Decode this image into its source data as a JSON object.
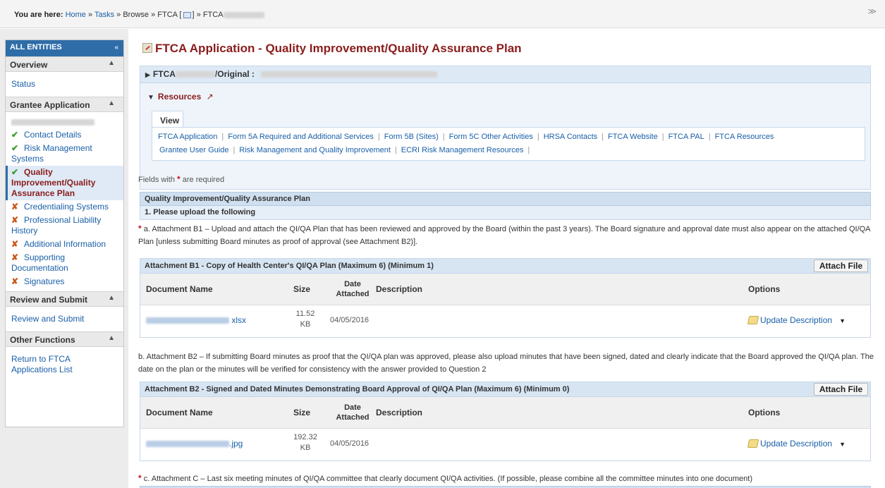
{
  "breadcrumb": {
    "prefix": "You are here:",
    "home": "Home",
    "tasks": "Tasks",
    "browse": "Browse",
    "ftca": "FTCA [",
    "ftca_close": "]",
    "current": "FTCA",
    "sep": "»"
  },
  "top_collapse_icon": "≫",
  "sidebar": {
    "title": "ALL ENTITIES",
    "collapse_icon": "«",
    "overview": {
      "label": "Overview",
      "items": [
        "Status"
      ]
    },
    "grantee": {
      "label": "Grantee Application",
      "items": [
        {
          "label": "Contact Details",
          "status": "complete"
        },
        {
          "label": "Risk Management Systems",
          "status": "complete"
        },
        {
          "label": "Quality Improvement/Quality Assurance Plan",
          "status": "complete",
          "active": true
        },
        {
          "label": "Credentialing Systems",
          "status": "incomplete"
        },
        {
          "label": "Professional Liability History",
          "status": "incomplete"
        },
        {
          "label": "Additional Information",
          "status": "incomplete"
        },
        {
          "label": "Supporting Documentation",
          "status": "incomplete"
        },
        {
          "label": "Signatures",
          "status": "incomplete"
        }
      ]
    },
    "review": {
      "label": "Review and Submit",
      "items": [
        "Review and Submit"
      ]
    },
    "other": {
      "label": "Other Functions",
      "items": [
        "Return to FTCA Applications List"
      ]
    }
  },
  "page_title": "FTCA Application - Quality Improvement/Quality Assurance Plan",
  "app_bar": {
    "prefix": "FTCA",
    "suffix": "/Original :"
  },
  "resources": {
    "label": "Resources",
    "view_tab": "View",
    "links_row1": [
      "FTCA Application",
      "Form 5A Required and Additional Services",
      "Form 5B (Sites)",
      "Form 5C Other Activities",
      "HRSA Contacts",
      "FTCA Website",
      "FTCA PAL",
      "FTCA Resources"
    ],
    "links_row2": [
      "Grantee User Guide",
      "Risk Management and Quality Improvement",
      "ECRI Risk Management Resources"
    ]
  },
  "required_note": {
    "before": "Fields with",
    "after": "are required"
  },
  "section": {
    "title": "Quality Improvement/Quality Assurance Plan",
    "subtitle": "1. Please upload the following"
  },
  "para_a": "a. Attachment B1 – Upload and attach the QI/QA Plan that has been reviewed and approved by the Board (within the past 3 years). The Board signature and approval date must also appear on the attached QI/QA Plan [unless submitting Board minutes as proof of approval (see Attachment B2)].",
  "para_b": "b. Attachment B2 – If submitting Board minutes as proof that the QI/QA plan was approved, please also upload minutes that have been signed, dated and clearly indicate that the Board approved the QI/QA plan. The date on the plan or the minutes will be verified for consistency with the answer provided to Question 2",
  "para_c": "c. Attachment C – Last six meeting minutes of QI/QA committee that clearly document QI/QA activities. (If possible, please combine all the committee minutes into one document)",
  "columns": {
    "doc": "Document Name",
    "size": "Size",
    "date": "Date Attached",
    "desc": "Description",
    "options": "Options"
  },
  "attach_label": "Attach File",
  "update_label": "Update Description",
  "attachment_b1": {
    "title": "Attachment B1 - Copy of Health Center's QI/QA Plan (Maximum 6) (Minimum 1)",
    "rows": [
      {
        "ext": "xlsx",
        "size_value": "11.52",
        "size_unit": "KB",
        "date": "04/05/2016",
        "description": ""
      }
    ]
  },
  "attachment_b2": {
    "title": "Attachment B2 - Signed and Dated Minutes Demonstrating Board Approval of QI/QA Plan (Maximum 6) (Minimum 0)",
    "rows": [
      {
        "ext": ".jpg",
        "size_value": "192.32",
        "size_unit": "KB",
        "date": "04/05/2016",
        "description": ""
      }
    ]
  }
}
